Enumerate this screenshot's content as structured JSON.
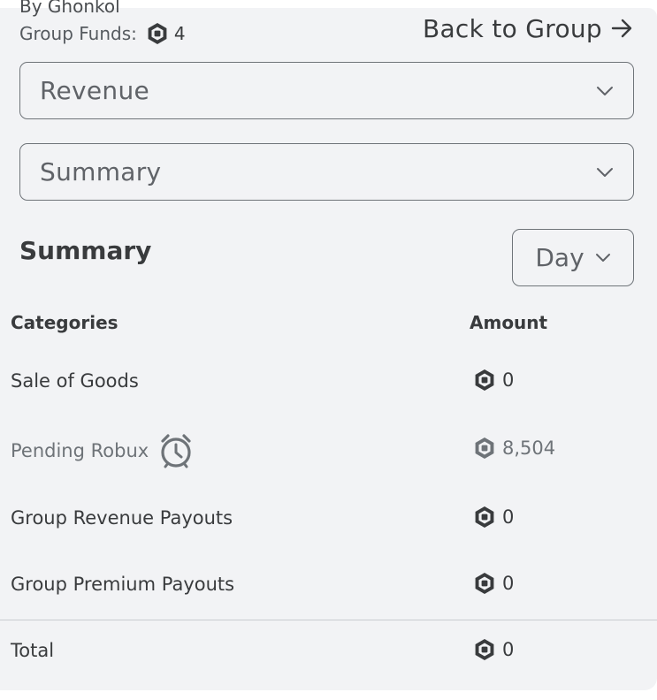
{
  "header": {
    "cut_off_text": "By Ghonkol",
    "funds_label": "Group Funds:",
    "funds_value": "4",
    "back_link": "Back to Group"
  },
  "dropdowns": {
    "category": "Revenue",
    "view": "Summary"
  },
  "summary": {
    "title": "Summary",
    "period": "Day",
    "columns": {
      "categories": "Categories",
      "amount": "Amount"
    },
    "rows": [
      {
        "label": "Sale of Goods",
        "amount": "0"
      },
      {
        "label": "Pending Robux",
        "amount": "8,504"
      },
      {
        "label": "Group Revenue Payouts",
        "amount": "0"
      },
      {
        "label": "Group Premium Payouts",
        "amount": "0"
      }
    ],
    "total": {
      "label": "Total",
      "amount": "0"
    }
  },
  "colors": {
    "panel_bg": "#f2f3f5",
    "text": "#393b3d",
    "muted_text": "#6e7378",
    "border": "#6f7479"
  },
  "icons": {
    "currency": "robux-icon",
    "pending": "alarm-clock-icon",
    "back": "arrow-right-icon",
    "dropdown": "chevron-down-icon"
  }
}
